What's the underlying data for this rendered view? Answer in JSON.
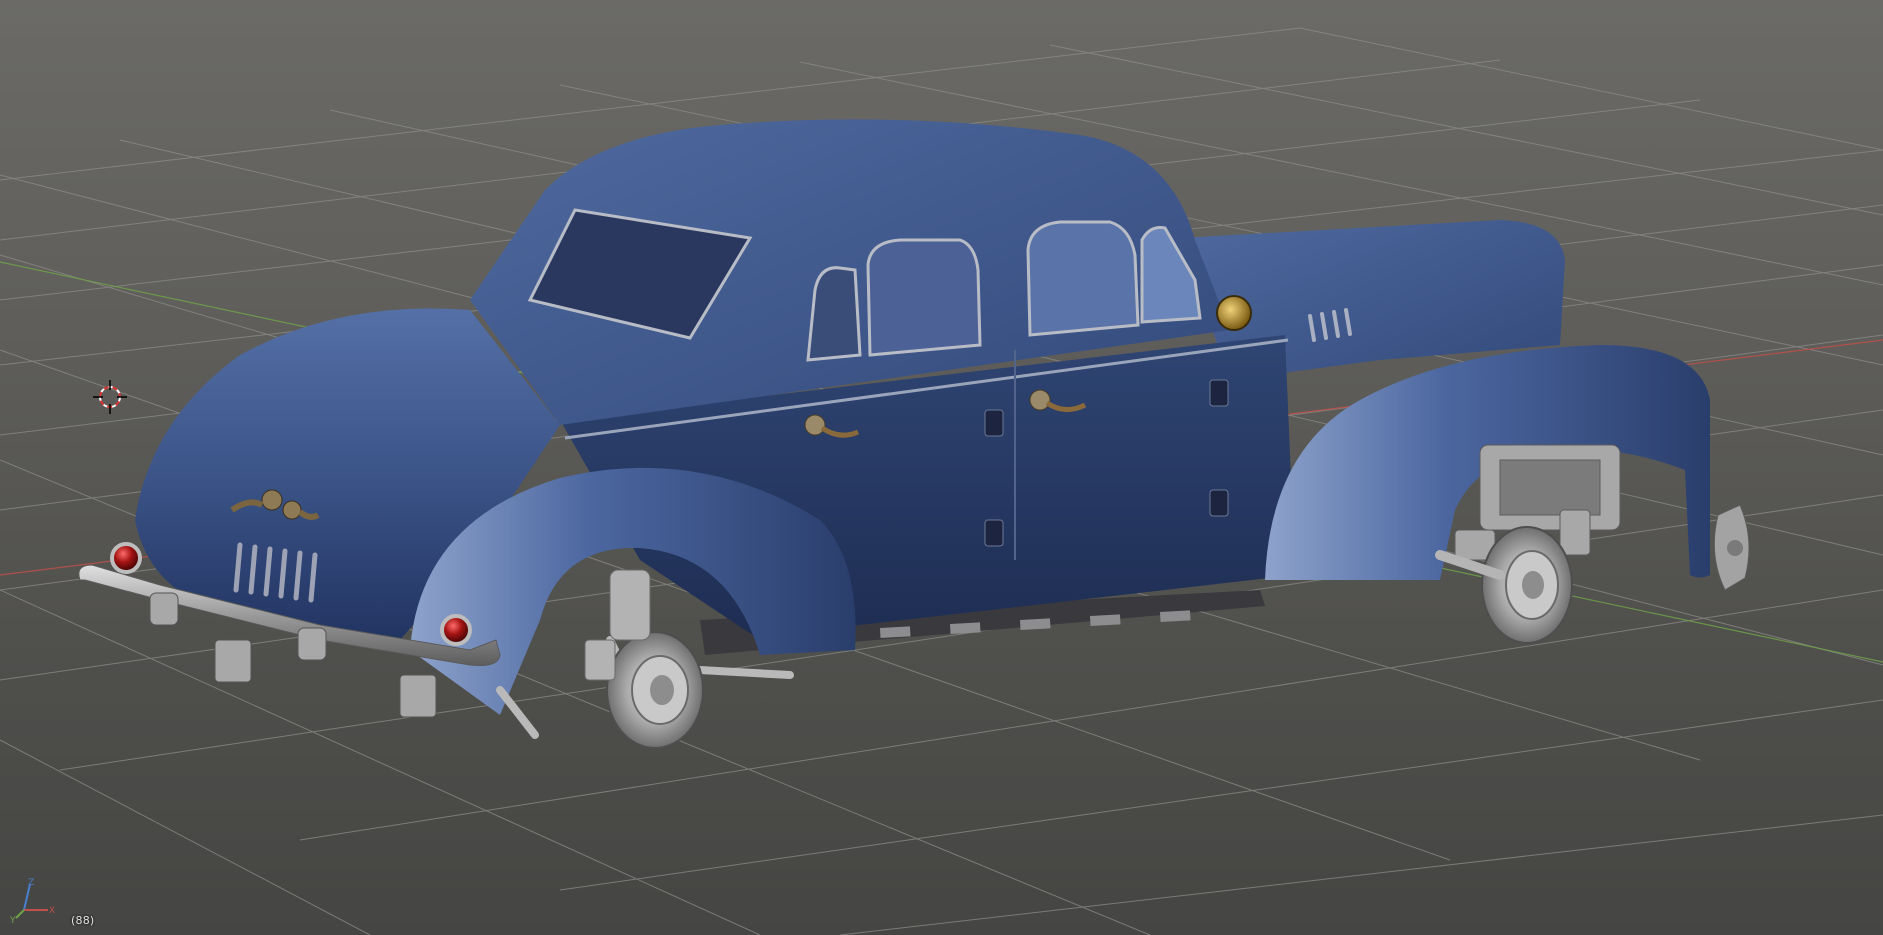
{
  "viewport": {
    "frame_label": "(88)",
    "background_color": "#5f5e5a",
    "grid_color": "#8c8c88",
    "x_axis_color": "#c0504a",
    "y_axis_color": "#6fa24a",
    "z_axis_color": "#4a7fd0"
  },
  "object": {
    "name_icon": "car-model",
    "body_color": "#3c5488",
    "chrome_color": "#b9b9b9",
    "tail_light_color": "#8a0d0d",
    "gauge_color": "#b8952e"
  },
  "widgets": {
    "cursor_icon": "3d-cursor-icon",
    "gizmo_icon": "axis-orientation-icon",
    "gizmo_labels": {
      "z": "Z",
      "y": "Y",
      "x": "X"
    }
  }
}
